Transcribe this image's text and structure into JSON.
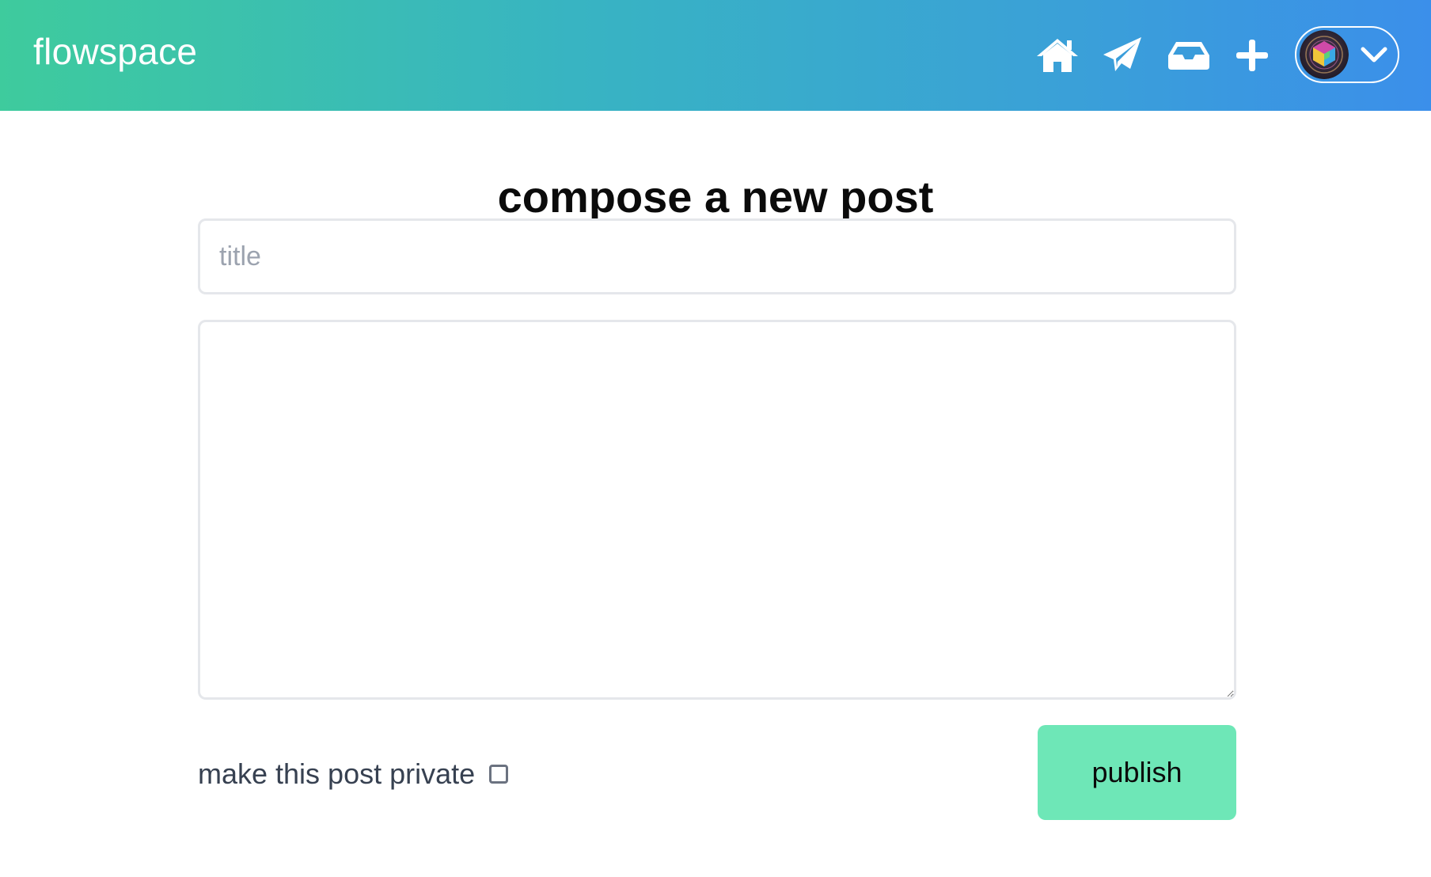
{
  "header": {
    "brand": "flowspace",
    "nav": [
      {
        "name": "home",
        "icon": "home-icon"
      },
      {
        "name": "send",
        "icon": "paper-plane-icon"
      },
      {
        "name": "inbox",
        "icon": "inbox-tray-icon"
      },
      {
        "name": "new-post",
        "icon": "plus-icon"
      }
    ],
    "user_menu": {
      "avatar_icon": "avatar-image",
      "dropdown_icon": "chevron-down-icon"
    }
  },
  "compose": {
    "heading": "compose a new post",
    "title_field": {
      "placeholder": "title",
      "value": ""
    },
    "body_field": {
      "placeholder": "",
      "value": ""
    },
    "private_label": "make this post private",
    "private_checked": false,
    "publish_label": "publish"
  },
  "colors": {
    "header_gradient_start": "#3ecb9d",
    "header_gradient_end": "#3b8fea",
    "publish_button": "#6ee7b7",
    "field_border": "#e5e7eb",
    "placeholder_text": "#9ca3af"
  }
}
